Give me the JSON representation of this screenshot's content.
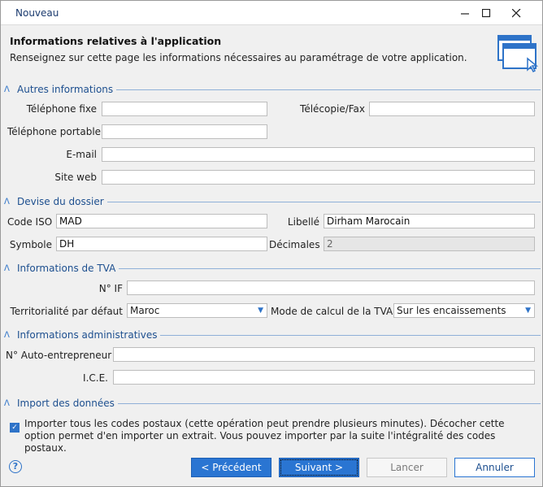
{
  "window": {
    "title": "Nouveau"
  },
  "header": {
    "title": "Informations relatives à l'application",
    "subtitle": "Renseignez sur cette page les informations nécessaires au paramétrage de votre application."
  },
  "sections": {
    "autres": "Autres informations",
    "devise": "Devise du dossier",
    "tva": "Informations de TVA",
    "admin": "Informations administratives",
    "import": "Import des données"
  },
  "autres": {
    "tel_fixe_label": "Téléphone fixe",
    "tel_fixe_value": "",
    "telecopie_label": "Télécopie/Fax",
    "telecopie_value": "",
    "tel_portable_label": "Téléphone portable",
    "tel_portable_value": "",
    "email_label": "E-mail",
    "email_value": "",
    "site_label": "Site web",
    "site_value": ""
  },
  "devise": {
    "code_label": "Code ISO",
    "code_value": "MAD",
    "libelle_label": "Libellé",
    "libelle_value": "Dirham Marocain",
    "symbole_label": "Symbole",
    "symbole_value": "DH",
    "decimales_label": "Décimales",
    "decimales_value": "2"
  },
  "tva": {
    "if_label": "N° IF",
    "if_value": "",
    "territorialite_label": "Territorialité par défaut",
    "territorialite_value": "Maroc",
    "mode_label": "Mode de calcul de la TVA",
    "mode_value": "Sur les encaissements"
  },
  "admin": {
    "auto_label": "N° Auto-entrepreneur",
    "auto_value": "",
    "ice_label": "I.C.E.",
    "ice_value": ""
  },
  "import": {
    "checked": true,
    "text": "Importer tous les codes postaux (cette opération peut prendre plusieurs minutes). Décocher cette option permet d'en importer un extrait. Vous pouvez importer par la suite l'intégralité des codes postaux."
  },
  "buttons": {
    "previous": "< Précédent",
    "next": "Suivant >",
    "cancel_disabled": "Lancer",
    "cancel": "Annuler",
    "help": "?"
  },
  "colors": {
    "accent": "#2a75d2",
    "section_text": "#1d4f8f"
  }
}
